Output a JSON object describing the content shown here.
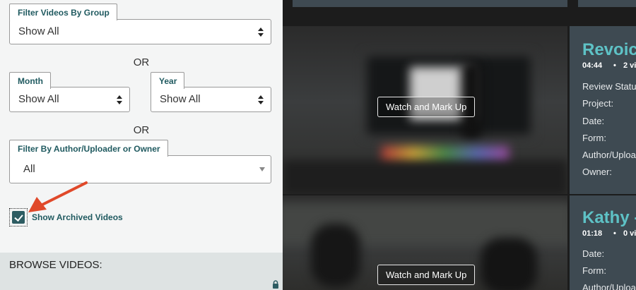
{
  "filters": {
    "group": {
      "label": "Filter Videos By Group",
      "value": "Show All"
    },
    "or_1": "OR",
    "month": {
      "label": "Month",
      "value": "Show All"
    },
    "year": {
      "label": "Year",
      "value": "Show All"
    },
    "or_2": "OR",
    "author": {
      "label": "Filter By Author/Uploader or Owner",
      "value": "All"
    },
    "show_archived": {
      "label": "Show Archived Videos",
      "checked": true
    }
  },
  "browse": {
    "title": "BROWSE VIDEOS:"
  },
  "colors": {
    "accent": "#205a60",
    "title_teal": "#5ec2c6",
    "card_bg": "#3e4a52",
    "arrow": "#e0492a"
  },
  "videos": [
    {
      "title": "Revoici",
      "duration": "04:44",
      "meta": "2 vi",
      "button": "Watch and Mark Up",
      "fields": [
        "Review Status",
        "Project:",
        "Date:",
        "Form:",
        "Author/Uploa",
        "Owner:"
      ]
    },
    {
      "title": "Kathy -",
      "duration": "01:18",
      "meta": "0 vi",
      "button": "Watch and Mark Up",
      "fields": [
        "Date:",
        "Form:",
        "Author/Uploa"
      ]
    }
  ]
}
